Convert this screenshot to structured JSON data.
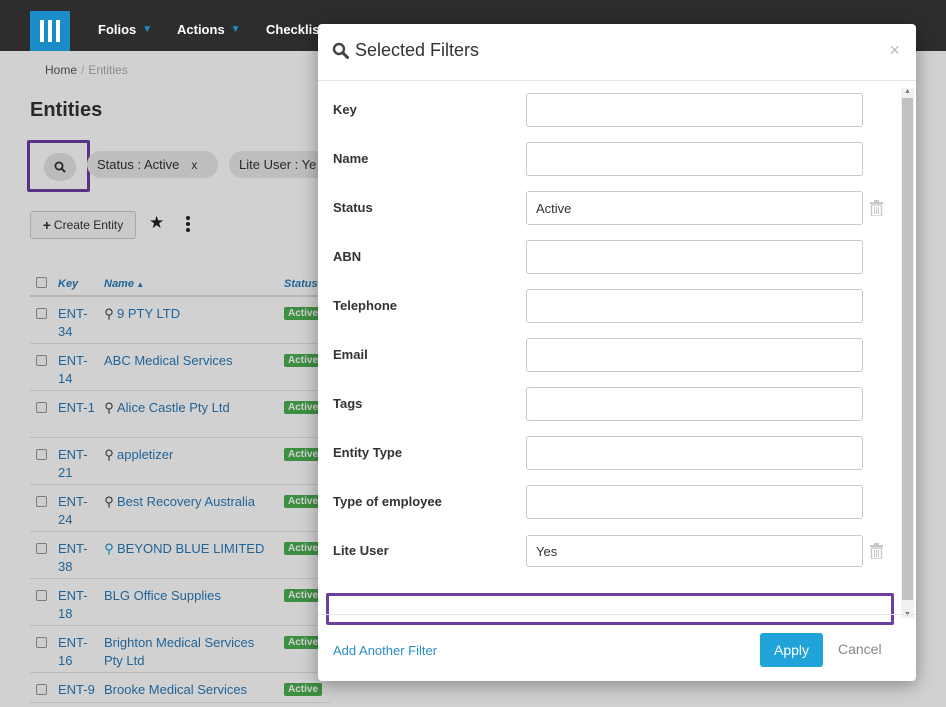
{
  "nav": {
    "items": [
      {
        "label": "Folios"
      },
      {
        "label": "Actions"
      },
      {
        "label": "Checklist"
      }
    ]
  },
  "breadcrumb": {
    "home": "Home",
    "separator": "/",
    "current": "Entities"
  },
  "page_title": "Entities",
  "filter_chips": [
    {
      "label": "Status : Active",
      "remove": "x"
    },
    {
      "label": "Lite User : Ye"
    }
  ],
  "toolbar": {
    "create_label": "Create Entity",
    "create_icon": "plus-icon"
  },
  "table": {
    "columns": [
      "Key",
      "Name",
      "Status"
    ],
    "rows": [
      {
        "key": "ENT-34",
        "key_display": "ENT-\n34",
        "name": "9 PTY LTD",
        "icon": "tie",
        "status": "Active"
      },
      {
        "key": "ENT-14",
        "key_display": "ENT-\n14",
        "name": "ABC Medical Services",
        "icon": "",
        "status": "Active"
      },
      {
        "key": "ENT-1",
        "key_display": "ENT-1",
        "name": "Alice Castle Pty Ltd",
        "icon": "tie",
        "status": "Active"
      },
      {
        "key": "ENT-21",
        "key_display": "ENT-\n21",
        "name": "appletizer",
        "icon": "tie",
        "status": "Active"
      },
      {
        "key": "ENT-24",
        "key_display": "ENT-\n24",
        "name": "Best Recovery Australia",
        "icon": "tie",
        "status": "Active"
      },
      {
        "key": "ENT-38",
        "key_display": "ENT-\n38",
        "name": "BEYOND BLUE LIMITED",
        "icon": "tie-blue",
        "status": "Active"
      },
      {
        "key": "ENT-18",
        "key_display": "ENT-\n18",
        "name": "BLG Office Supplies",
        "icon": "",
        "status": "Active"
      },
      {
        "key": "ENT-16",
        "key_display": "ENT-\n16",
        "name": "Brighton Medical Services Pty Ltd",
        "icon": "",
        "status": "Active"
      },
      {
        "key": "ENT-9",
        "key_display": "ENT-9",
        "name": "Brooke Medical Services",
        "icon": "",
        "status": "Active"
      }
    ]
  },
  "modal": {
    "title": "Selected Filters",
    "close": "×",
    "fields": [
      {
        "label": "Key",
        "value": ""
      },
      {
        "label": "Name",
        "value": ""
      },
      {
        "label": "Status",
        "value": "Active"
      },
      {
        "label": "ABN",
        "value": ""
      },
      {
        "label": "Telephone",
        "value": ""
      },
      {
        "label": "Email",
        "value": ""
      },
      {
        "label": "Tags",
        "value": ""
      },
      {
        "label": "Entity Type",
        "value": ""
      },
      {
        "label": "Type of employee",
        "value": ""
      },
      {
        "label": "Lite User",
        "value": "Yes"
      }
    ],
    "add_filter": "Add Another Filter",
    "apply": "Apply",
    "cancel": "Cancel"
  },
  "colors": {
    "nav_bg": "#2d2d2d",
    "brand_blue": "#1a8dc8",
    "link": "#2a7ab8",
    "apply_btn": "#1fa3d8",
    "highlight": "#6b3fa0",
    "status_active": "#4caf50"
  }
}
